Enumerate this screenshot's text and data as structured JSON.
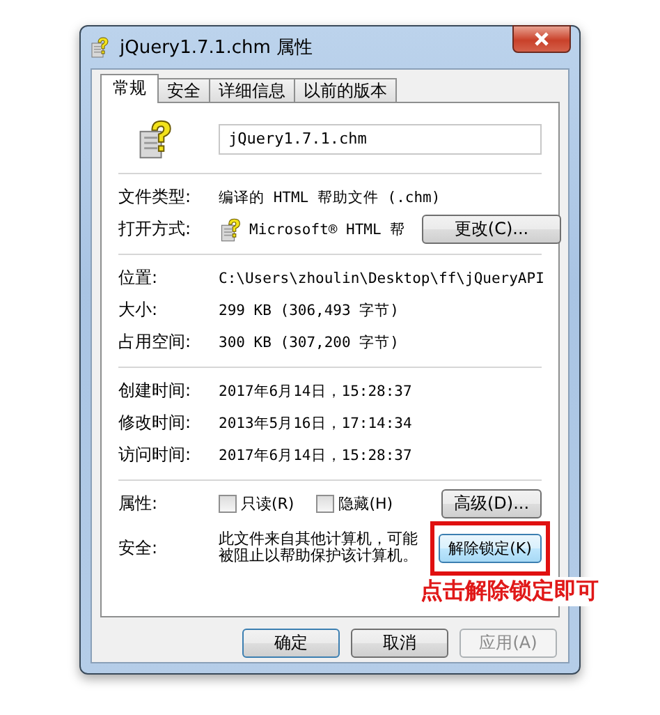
{
  "window": {
    "title": "jQuery1.7.1.chm 属性"
  },
  "tabs": [
    {
      "label": "常规",
      "selected": true
    },
    {
      "label": "安全",
      "selected": false
    },
    {
      "label": "详细信息",
      "selected": false
    },
    {
      "label": "以前的版本",
      "selected": false
    }
  ],
  "file_name": "jQuery1.7.1.chm",
  "sections": [
    {
      "rows": [
        {
          "kind": "text",
          "label": "文件类型:",
          "value": "编译的 HTML 帮助文件 (.chm)"
        },
        {
          "kind": "app",
          "label": "打开方式:",
          "value": "Microsoft® HTML 帮",
          "button": "更改(C)..."
        }
      ]
    },
    {
      "rows": [
        {
          "kind": "text",
          "label": "位置:",
          "value": "C:\\Users\\zhoulin\\Desktop\\ff\\jQueryAPI"
        },
        {
          "kind": "text",
          "label": "大小:",
          "value": "299 KB (306,493 字节)"
        },
        {
          "kind": "text",
          "label": "占用空间:",
          "value": "300 KB (307,200 字节)"
        }
      ]
    },
    {
      "rows": [
        {
          "kind": "text",
          "label": "创建时间:",
          "value": "2017年6月14日，15:28:37"
        },
        {
          "kind": "text",
          "label": "修改时间:",
          "value": "2013年5月16日，17:14:34"
        },
        {
          "kind": "text",
          "label": "访问时间:",
          "value": "2017年6月14日，15:28:37"
        }
      ]
    },
    {
      "rows": [
        {
          "kind": "checks",
          "label": "属性:",
          "checkboxes": [
            {
              "label": "只读(R)",
              "checked": false
            },
            {
              "label": "隐藏(H)",
              "checked": false
            }
          ],
          "button": "高级(D)..."
        },
        {
          "kind": "note",
          "label": "安全:",
          "value": "此文件来自其他计算机，可能被阻止以帮助保护该计算机。",
          "button": "解除锁定(K)",
          "highlighted": true
        }
      ]
    }
  ],
  "footer_buttons": [
    {
      "label": "确定",
      "disabled": false
    },
    {
      "label": "取消",
      "disabled": false
    },
    {
      "label": "应用(A)",
      "disabled": true
    }
  ],
  "annotation": {
    "text": "点击解除锁定即可"
  }
}
